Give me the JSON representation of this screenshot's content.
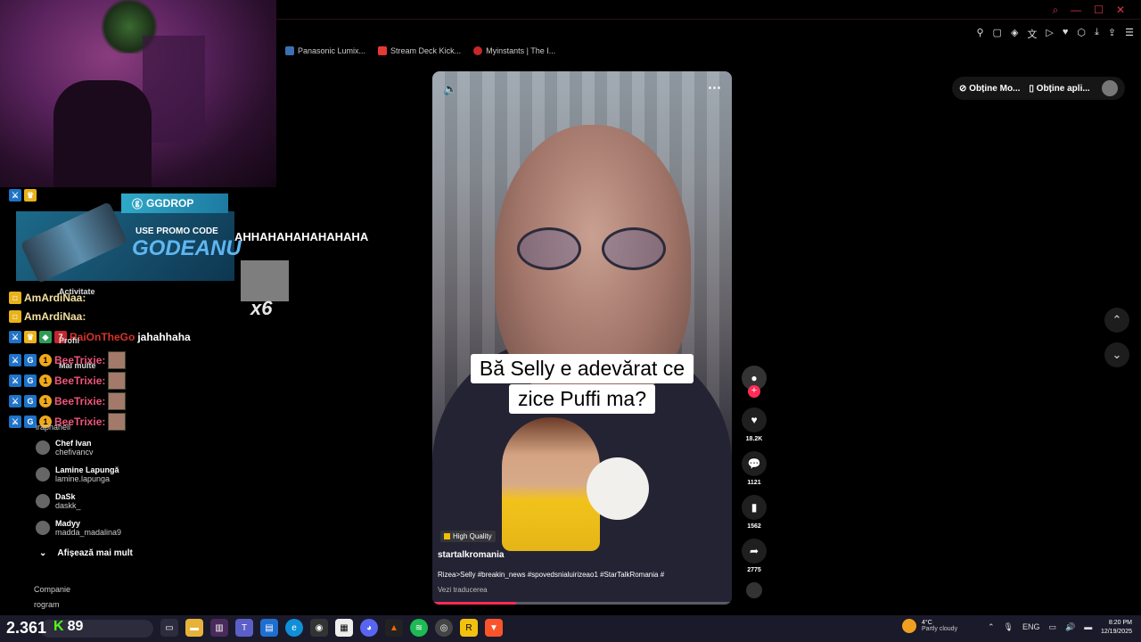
{
  "browser": {
    "bookmarks": [
      {
        "label": "Panasonic Lumix...",
        "color": "#3d6fb3"
      },
      {
        "label": "Stream Deck Kick...",
        "color": "#e53935"
      },
      {
        "label": "Myinstants | The I...",
        "color": "#c62828"
      }
    ],
    "window_controls": [
      "search-icon",
      "minimize-icon",
      "maximize-icon",
      "close-icon"
    ],
    "toolbar_icons": [
      "pin-icon",
      "tab-icon",
      "shield-icon",
      "translate-icon",
      "play-icon",
      "heart-icon",
      "extensions-icon",
      "download-icon",
      "share-icon",
      "menu-icon"
    ]
  },
  "tiktok": {
    "get_mode": "Obține Mo...",
    "get_app": "Obține apli...",
    "caption_line1": "Bă Selly e adevărat ce",
    "caption_line2": "zice Puffi ma?",
    "badge": "High Quality",
    "author": "startalkromania",
    "description": "Rizea>Selly #breakin_news #spovedsnialuirizeao1 #StarTalkRomania #",
    "translate": "Vezi traducerea",
    "progress_percent": 28,
    "counts": {
      "likes": "18.2K",
      "comments": "1121",
      "saves": "1562",
      "shares": "2775"
    },
    "accent_color": "#fe2c55"
  },
  "overlay": {
    "promo_brand": "GGDROP",
    "promo_line1": "USE PROMO CODE",
    "promo_code": "GODEANU",
    "laugh_text": "AHHAHAHAHAHAHAHA",
    "multiplier": "x6",
    "activity_label": "Activitate",
    "profile_label": "Profil",
    "more_label": "Mai multe",
    "chat": [
      {
        "nick": "RaiOnTheGo",
        "text": "jahahhaha"
      },
      {
        "nick": "BeeTrixie:",
        "text": ""
      },
      {
        "nick": "BeeTrixie:",
        "text": ""
      },
      {
        "nick": "BeeTrixie:",
        "text": ""
      },
      {
        "nick": "BeeTrixie:",
        "text": ""
      }
    ],
    "amardi_1": "AmArdiNaa:",
    "amardi_2": "AmArdiNaa:",
    "streamers": [
      {
        "name": "",
        "user": "iraphahell"
      },
      {
        "name": "Chef Ivan",
        "user": "chefivancv"
      },
      {
        "name": "Lamine Lapungă",
        "user": "lamine.lapunga"
      },
      {
        "name": "DaSk",
        "user": "daskk_"
      },
      {
        "name": "Madyy",
        "user": "madda_madalina9"
      }
    ],
    "show_more": "Afișează mai mult",
    "company_1": "Companie",
    "company_2": "rogram"
  },
  "taskbar": {
    "counter": "2.361",
    "kick_count": "89",
    "weather_temp": "4°C",
    "weather_desc": "Partly cloudy",
    "language": "ENG",
    "time": "8:20 PM",
    "date": "12/19/2025"
  }
}
